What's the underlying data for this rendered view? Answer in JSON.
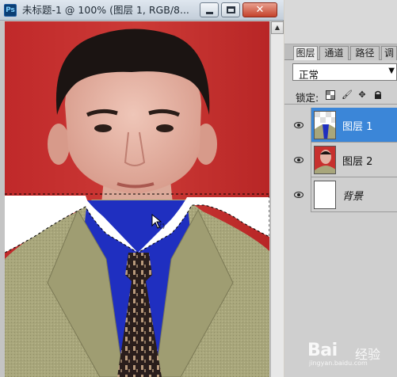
{
  "window": {
    "app_icon": "Ps",
    "title": "未标题-1 @ 100% (图层 1, RGB/8...",
    "close_glyph": "✕"
  },
  "panel": {
    "tabs": [
      {
        "label": "图层",
        "active": true
      },
      {
        "label": "通道",
        "active": false
      },
      {
        "label": "路径",
        "active": false
      },
      {
        "label": "调",
        "active": false
      }
    ],
    "blend_mode": "正常",
    "lock_label": "锁定:",
    "layers": [
      {
        "name": "图层 1",
        "selected": true,
        "visible": true,
        "thumbnail": "suit-transparent"
      },
      {
        "name": "图层 2",
        "selected": false,
        "visible": true,
        "thumbnail": "portrait-red"
      },
      {
        "name": "背景",
        "selected": false,
        "visible": true,
        "thumbnail": "white"
      }
    ]
  },
  "watermark": {
    "logo": "Bai",
    "suffix": "经验",
    "url": "jingyan.baidu.com"
  },
  "colors": {
    "background_red": "#c7302e",
    "selection_blue": "#3b86d8",
    "shirt_blue": "#1f2fc0",
    "suit_khaki": "#a9a77a"
  }
}
